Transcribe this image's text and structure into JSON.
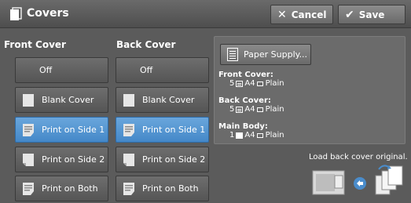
{
  "header": {
    "title": "Covers",
    "title_icon": "covers-icon",
    "cancel_label": "Cancel",
    "save_label": "Save"
  },
  "front_cover": {
    "heading": "Front Cover",
    "options": [
      {
        "label": "Off",
        "icon": ""
      },
      {
        "label": "Blank Cover",
        "icon": "blank-cover-icon"
      },
      {
        "label": "Print on Side 1",
        "icon": "print-side1-icon"
      },
      {
        "label": "Print on Side 2",
        "icon": "print-side2-icon"
      },
      {
        "label": "Print on Both",
        "icon": "print-both-icon"
      }
    ],
    "selected": "Print on Side 1"
  },
  "back_cover": {
    "heading": "Back Cover",
    "options": [
      {
        "label": "Off",
        "icon": ""
      },
      {
        "label": "Blank Cover",
        "icon": "blank-cover-icon"
      },
      {
        "label": "Print on Side 1",
        "icon": "print-side1-icon"
      },
      {
        "label": "Print on Side 2",
        "icon": "print-side2-icon"
      },
      {
        "label": "Print on Both",
        "icon": "print-both-icon"
      }
    ],
    "selected": "Print on Side 1"
  },
  "summary": {
    "paper_supply_label": "Paper Supply...",
    "front_cover_label": "Front Cover:",
    "front_cover_tray": "5",
    "front_cover_size": "A4",
    "front_cover_type": "Plain",
    "back_cover_label": "Back Cover:",
    "back_cover_tray": "5",
    "back_cover_size": "A4",
    "back_cover_type": "Plain",
    "main_body_label": "Main Body:",
    "main_body_tray": "1",
    "main_body_size": "A4",
    "main_body_type": "Plain"
  },
  "instruction": "Load back cover original.",
  "colors": {
    "selected": "#4a8ccb",
    "background": "#5b5b5b",
    "button": "#666666"
  }
}
